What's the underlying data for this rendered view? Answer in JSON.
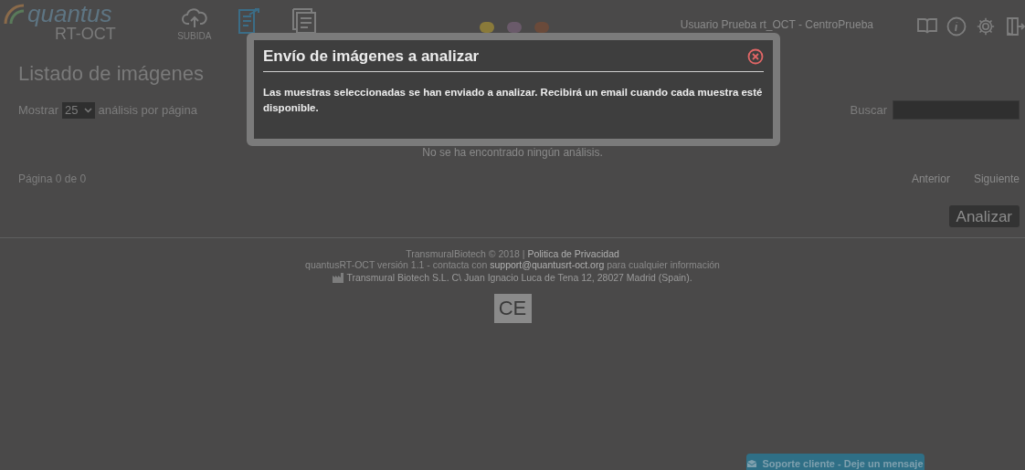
{
  "logo": {
    "name": "quantus",
    "product": "RT-OCT"
  },
  "nav": [
    {
      "label": "SUBIDA",
      "kind": "upload",
      "selected": false
    },
    {
      "kind": "send",
      "selected": true
    },
    {
      "kind": "list",
      "selected": false
    }
  ],
  "user": "Usuario Prueba rt_OCT - CentroPrueba",
  "page_title": "Listado de imágenes",
  "show": {
    "prefix": "Mostrar",
    "value": "25",
    "suffix": "análisis por página"
  },
  "search": {
    "label": "Buscar"
  },
  "empty_message": "No se ha encontrado ningún análisis.",
  "pagination": {
    "info": "Página 0 de 0",
    "previous": "Anterior",
    "next": "Siguiente"
  },
  "analyze_button": "Analizar",
  "footer": {
    "copyright": "TransmuralBiotech © 2018 |",
    "privacy_link": "Politica de Privacidad",
    "version_prefix": "quantusRT-OCT versión 1.1 - contacta con",
    "email": "support@quantusrt-oct.org",
    "version_suffix": "para cualquier información",
    "address": "Transmural Biotech S.L. C\\ Juan Ignacio Luca de Tena 12, 28027 Madrid (Spain).",
    "ce_mark": "CE"
  },
  "support_tab": "Soporte cliente - Deje un mensaje",
  "dialog": {
    "title": "Envío de imágenes a analizar",
    "message": "Las muestras seleccionadas se han enviado a analizar. Recibirá un email cuando cada muestra esté disponible."
  }
}
